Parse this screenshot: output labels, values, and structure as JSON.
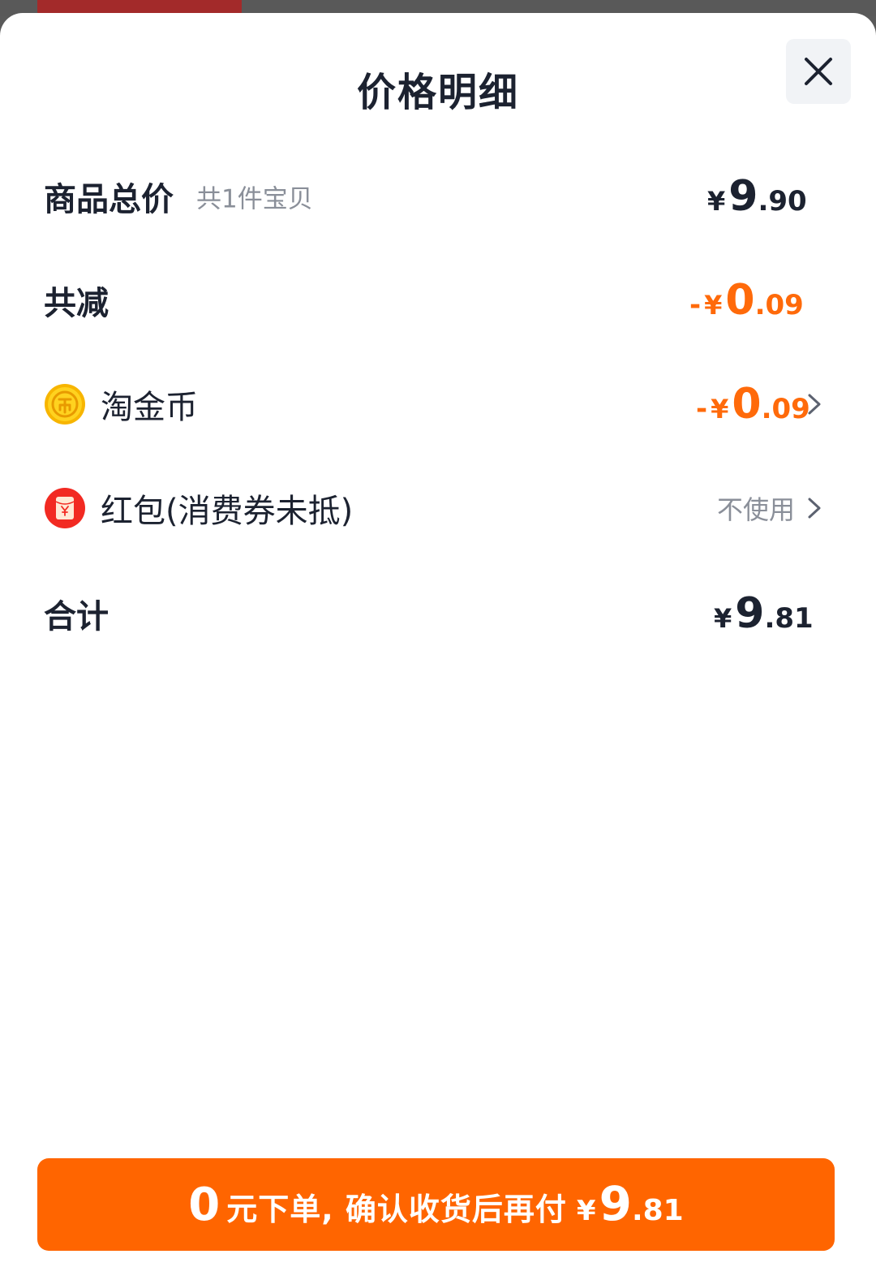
{
  "sheet": {
    "title": "价格明细",
    "close_icon": "close-icon"
  },
  "rows": {
    "subtotal": {
      "label": "商品总价",
      "sub": "共1件宝贝",
      "yen": "¥",
      "int": "9",
      "dec": ".90"
    },
    "discount": {
      "label": "共减",
      "minus": "-",
      "yen": "¥",
      "int": "0",
      "dec": ".09"
    },
    "coins": {
      "icon": "gold-coin-icon",
      "label": "淘金币",
      "minus": "-",
      "yen": "¥",
      "int": "0",
      "dec": ".09"
    },
    "redpacket": {
      "icon": "red-packet-icon",
      "label": "红包(消费券未抵)",
      "value": "不使用"
    },
    "total": {
      "label": "合计",
      "yen": "¥",
      "int": "9",
      "dec": ".81"
    }
  },
  "cta": {
    "zero": "0",
    "text": "元下单, 确认收货后再付",
    "yen": "¥",
    "int": "9",
    "dec": ".81"
  },
  "colors": {
    "accent": "#ff6500",
    "discount": "#ff6a0a",
    "text": "#1c2230",
    "muted": "#8a8f99"
  }
}
